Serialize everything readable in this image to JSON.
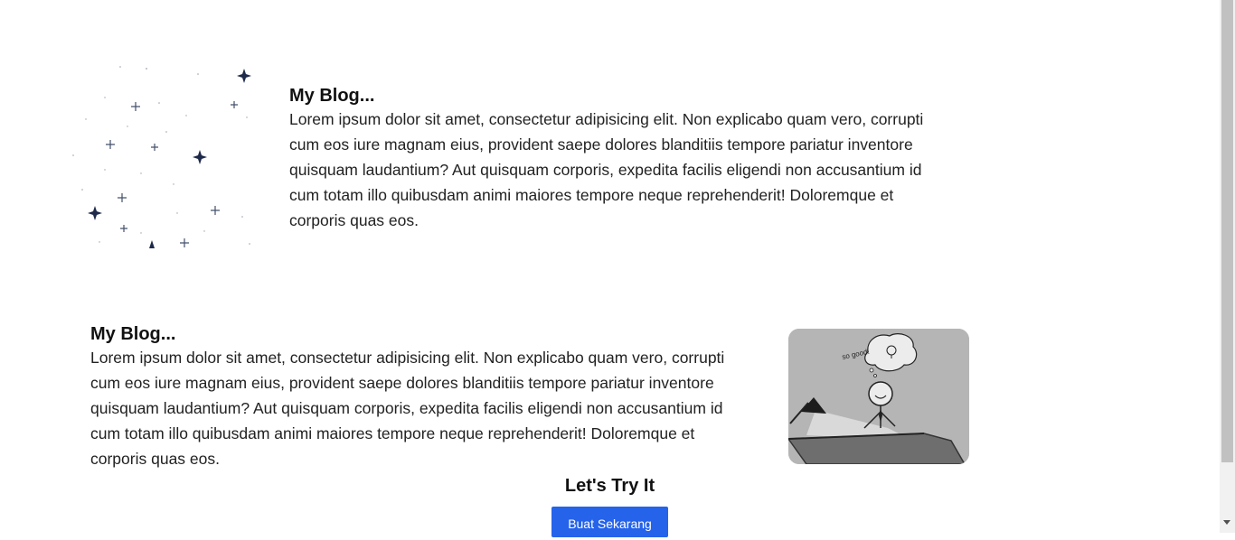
{
  "blog_top": {
    "title": "My Blog...",
    "body": "Lorem ipsum dolor sit amet, consectetur adipisicing elit. Non explicabo quam vero, corrupti cum eos iure magnam eius, provident saepe dolores blanditiis tempore pariatur inventore quisquam laudantium? Aut quisquam corporis, expedita facilis eligendi non accusantium id cum totam illo quibusdam animi maiores tempore neque reprehenderit! Doloremque et corporis quas eos."
  },
  "blog_bottom": {
    "title": "My Blog...",
    "body": "Lorem ipsum dolor sit amet, consectetur adipisicing elit. Non explicabo quam vero, corrupti cum eos iure magnam eius, provident saepe dolores blanditiis tempore pariatur inventore quisquam laudantium? Aut quisquam corporis, expedita facilis eligendi non accusantium id cum totam illo quibusdam animi maiores tempore neque reprehenderit! Doloremque et corporis quas eos.",
    "thought_text": "so good!"
  },
  "cta": {
    "title": "Let's Try It",
    "button_label": "Buat Sekarang"
  },
  "colors": {
    "button": "#2563eb",
    "sparkle": "#1e2a4a",
    "illustration_bg": "#b5b5b5"
  }
}
